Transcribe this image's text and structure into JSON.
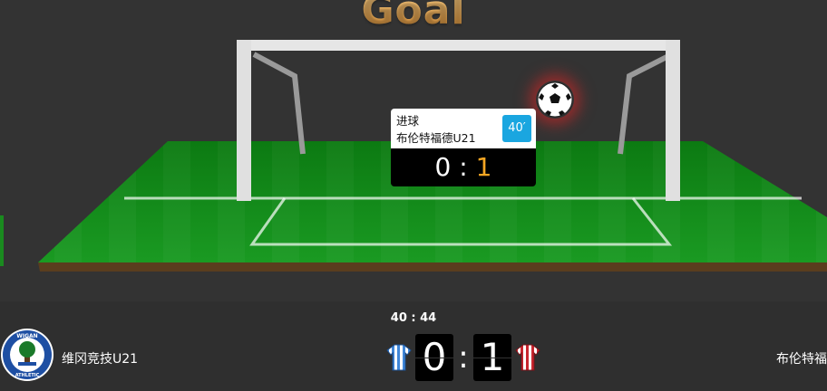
{
  "banner": {
    "title": "Goal"
  },
  "event": {
    "type_label": "进球",
    "team_label": "布伦特福德U21",
    "minute": "40′",
    "score_home": "0",
    "score_sep": ":",
    "score_away": "1"
  },
  "match": {
    "clock": "40 : 44",
    "home": {
      "name": "维冈竞技U21",
      "score": "0",
      "logo_text": "WIGAN ATHLETIC"
    },
    "away": {
      "name": "布伦特福",
      "score": "1"
    },
    "score_sep": ":"
  },
  "colors": {
    "pitch_green": "#128a1a",
    "title_gold": "#e6a14a",
    "minute_badge": "#1aa6e0",
    "highlight_score": "#f5a623",
    "home_kit": "#3f86d8",
    "away_kit": "#c8262f"
  },
  "icons": {
    "ball": "soccer-ball-icon",
    "home_kit": "striped-shirt-blue-icon",
    "away_kit": "striped-shirt-red-icon",
    "home_logo": "wigan-athletic-crest-icon"
  }
}
